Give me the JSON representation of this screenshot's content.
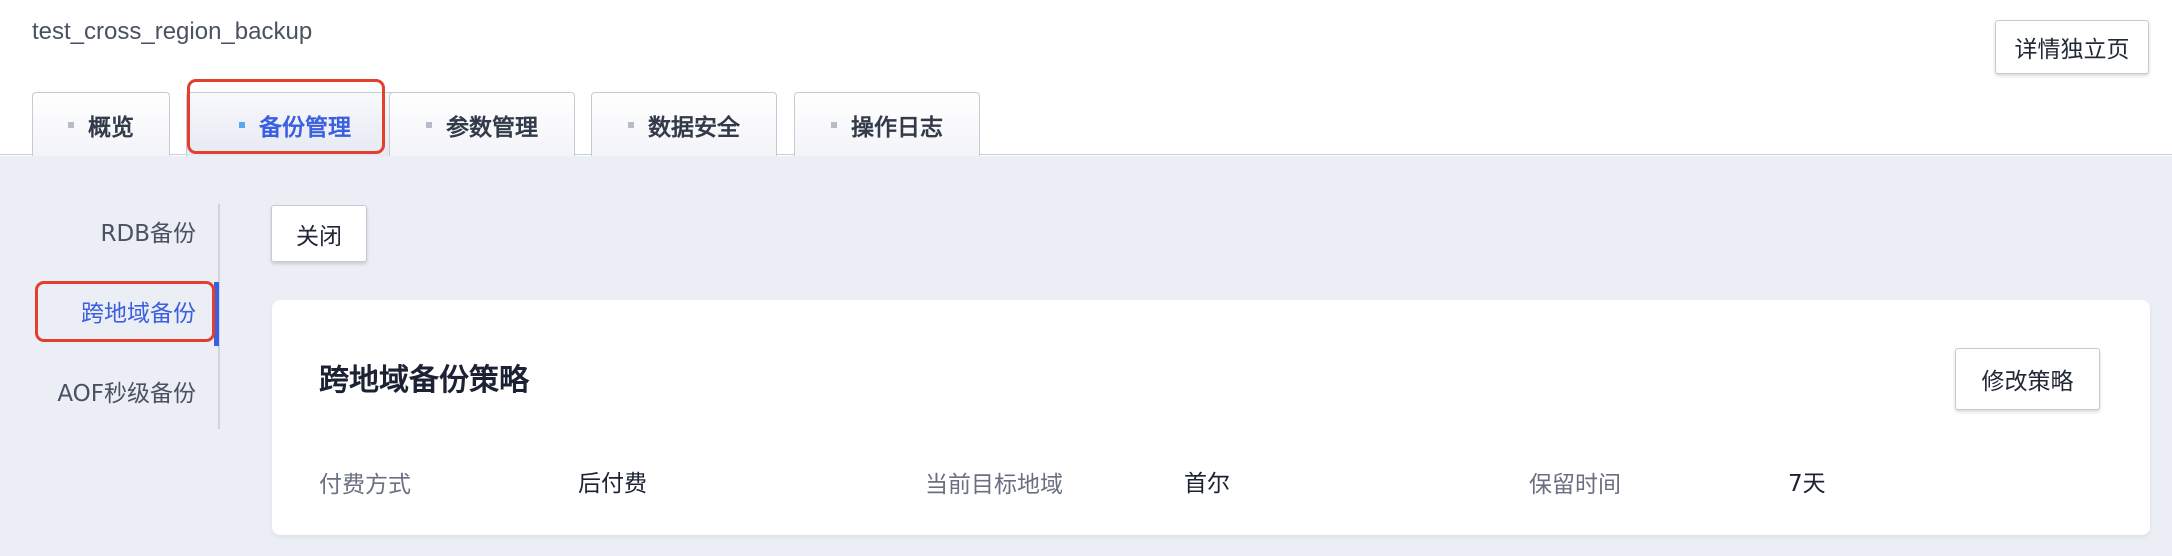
{
  "header": {
    "instance_name": "test_cross_region_backup",
    "detail_button": "详情独立页"
  },
  "tabs": [
    {
      "label": "概览",
      "active": false
    },
    {
      "label": "备份管理",
      "active": true
    },
    {
      "label": "参数管理",
      "active": false
    },
    {
      "label": "数据安全",
      "active": false
    },
    {
      "label": "操作日志",
      "active": false
    }
  ],
  "subnav": {
    "items": [
      {
        "label": "RDB备份",
        "active": false
      },
      {
        "label": "跨地域备份",
        "active": true
      },
      {
        "label": "AOF秒级备份",
        "active": false
      }
    ]
  },
  "toolbar": {
    "close_label": "关闭"
  },
  "policy_card": {
    "title": "跨地域备份策略",
    "modify_button": "修改策略",
    "fields": [
      {
        "label": "付费方式",
        "value": "后付费"
      },
      {
        "label": "当前目标地域",
        "value": "首尔"
      },
      {
        "label": "保留时间",
        "value": "7天"
      }
    ]
  },
  "colors": {
    "accent": "#3a5fe0",
    "highlight": "#e2402c",
    "content_bg": "#eceef5"
  }
}
